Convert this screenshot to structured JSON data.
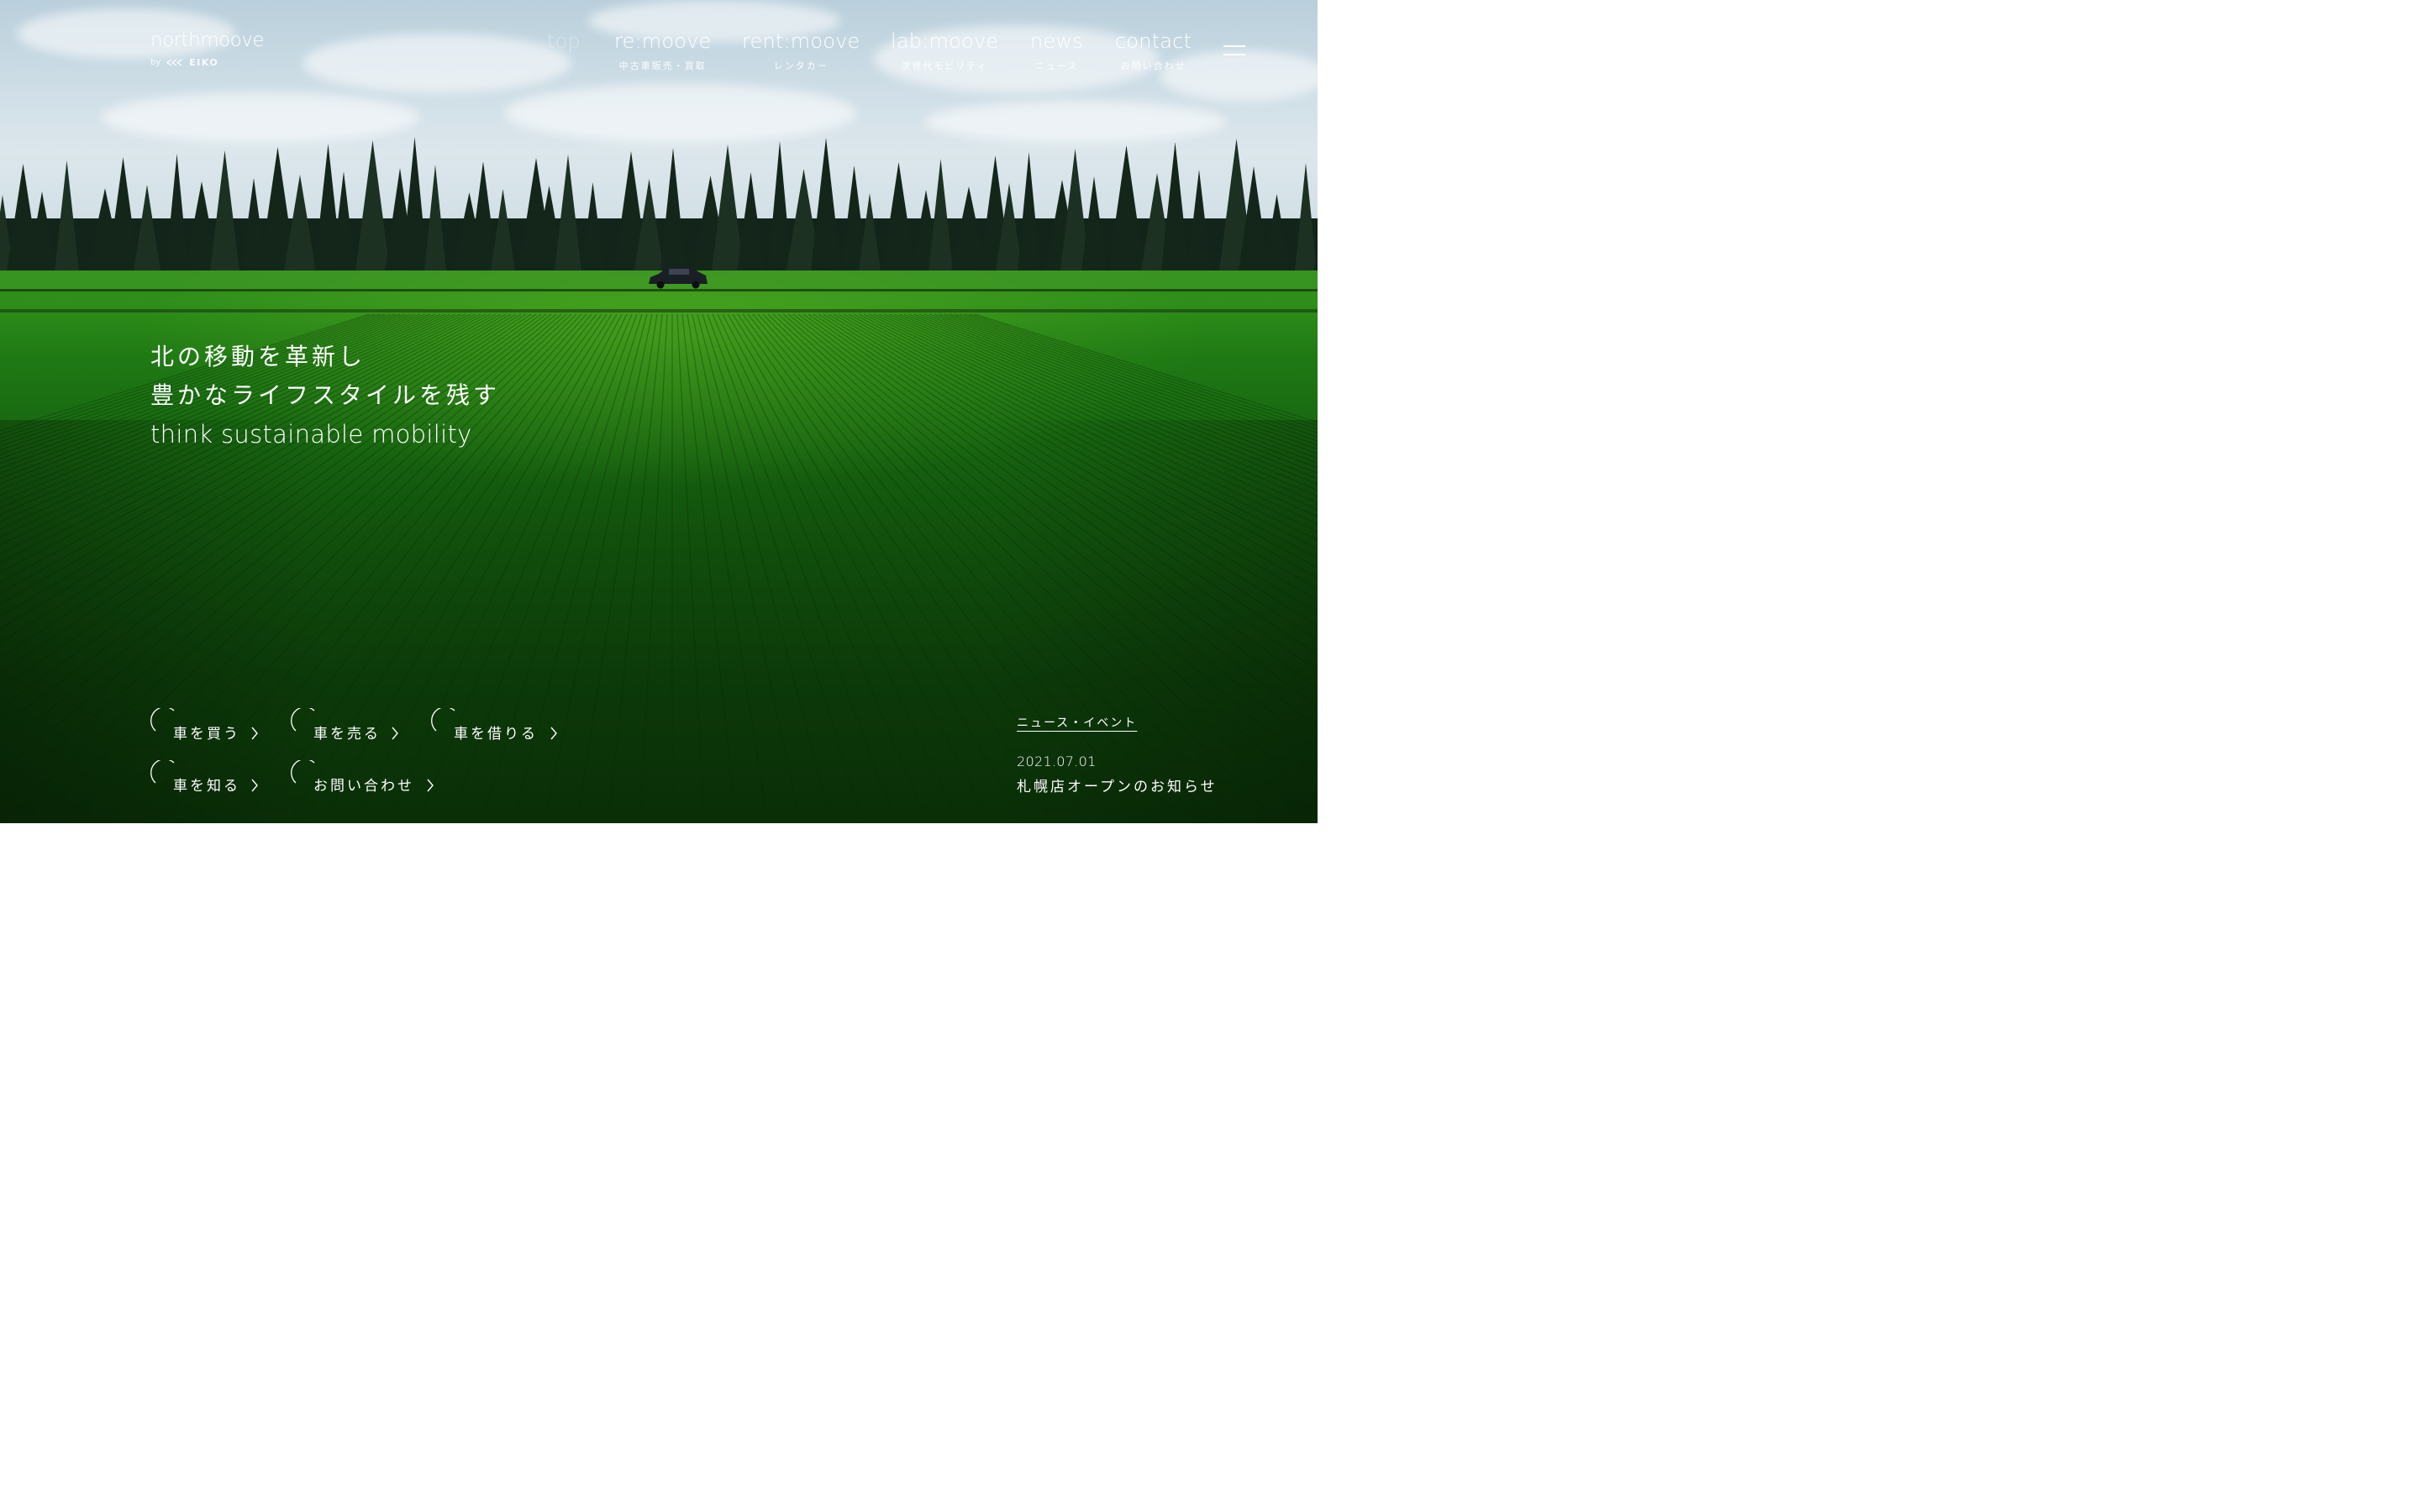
{
  "brand": {
    "name": "northmoove",
    "by": "by",
    "company": "EIKO"
  },
  "nav": {
    "items": [
      {
        "en": "top",
        "jp": "",
        "active": true
      },
      {
        "en": "re:moove",
        "jp": "中古車販売・買取"
      },
      {
        "en": "rent:moove",
        "jp": "レンタカー"
      },
      {
        "en": "lab:moove",
        "jp": "次世代モビリティ"
      },
      {
        "en": "news",
        "jp": "ニュース"
      },
      {
        "en": "contact",
        "jp": "お問い合わせ"
      }
    ],
    "menu_icon": "hamburger-menu-icon"
  },
  "hero": {
    "line1": "北の移動を革新し",
    "line2": "豊かなライフスタイルを残す",
    "line3": "think sustainable mobility"
  },
  "actions": [
    {
      "label": "車を買う"
    },
    {
      "label": "車を売る"
    },
    {
      "label": "車を借りる"
    },
    {
      "label": "車を知る"
    },
    {
      "label": "お問い合わせ"
    }
  ],
  "news": {
    "heading": "ニュース・イベント",
    "items": [
      {
        "date": "2021.07.01",
        "title": "札幌店オープンのお知らせ"
      }
    ]
  },
  "colors": {
    "text": "#ffffff",
    "sky": "#cddde6",
    "field": "#1f7a14",
    "forest": "#14241a"
  }
}
